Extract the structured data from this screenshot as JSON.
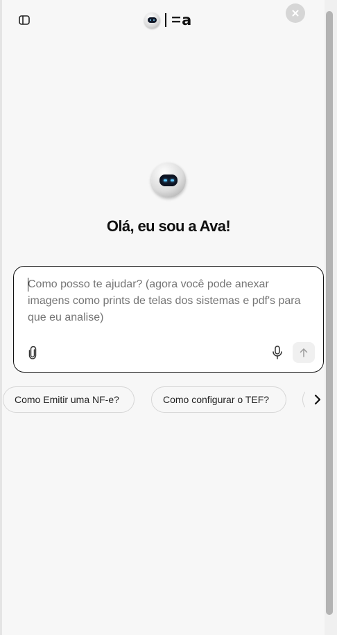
{
  "header": {
    "logo_text": "ꘌa",
    "icons": {
      "sidebar_toggle": "sidebar-panel-icon",
      "close": "close-icon"
    }
  },
  "main": {
    "greeting": "Olá, eu sou a Ava!"
  },
  "chat": {
    "placeholder": "Como posso te ajudar? (agora você pode anexar imagens como prints de telas dos sistemas e pdf's para que eu analise)",
    "icons": {
      "attach": "paperclip-icon",
      "mic": "microphone-icon",
      "send": "arrow-up-icon"
    }
  },
  "suggestions": [
    {
      "label": "Como Emitir uma NF-e?"
    },
    {
      "label": "Como configurar o TEF?"
    },
    {
      "label": ""
    }
  ],
  "colors": {
    "background": "#f7f7f7",
    "chat_border": "#111111",
    "chip_border": "#d6d6d6"
  }
}
